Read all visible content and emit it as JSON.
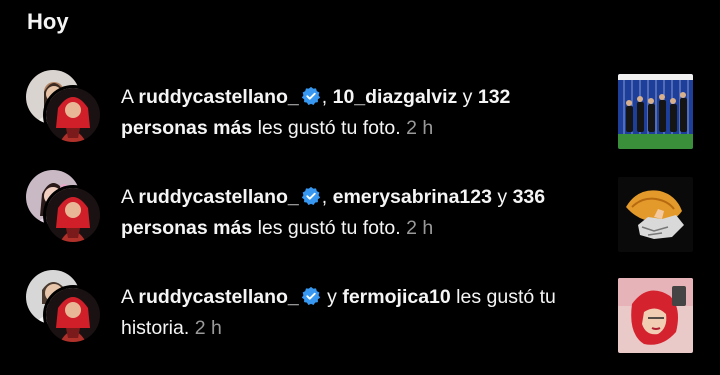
{
  "section": {
    "title": "Hoy"
  },
  "notifications": [
    {
      "prefix": "A ",
      "user1": "ruddycastellano_",
      "sep": ", ",
      "user2": "10_diazgalviz",
      "and": " y ",
      "others": "132 personas más",
      "action": " les gustó tu foto.",
      "time": "2 h"
    },
    {
      "prefix": "A ",
      "user1": "ruddycastellano_",
      "sep": ", ",
      "user2": "emerysabrina123",
      "and": " y ",
      "others": "336 personas más",
      "action": " les gustó tu foto.",
      "time": "2 h"
    },
    {
      "prefix": "A ",
      "user1": "ruddycastellano_",
      "and": " y ",
      "user2": "fermojica10",
      "action": " les gustó tu historia.",
      "time": "2 h"
    }
  ],
  "colors": {
    "background": "#000000",
    "text": "#f5f5f5",
    "muted": "#9a9a9a",
    "verified": "#3897f0"
  },
  "icons": {
    "verified": "verified-badge-icon"
  }
}
